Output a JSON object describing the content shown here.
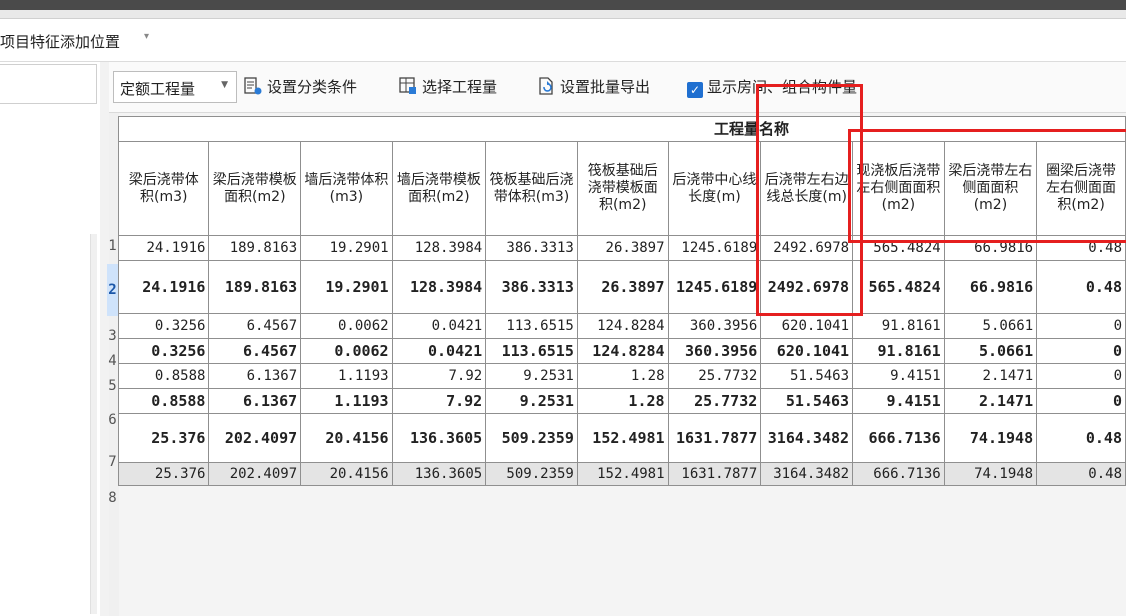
{
  "menu": {
    "label": "项目特征添加位置",
    "caret": "▾"
  },
  "toolbar": {
    "dropdown_value": "定额工程量",
    "set_classification": "设置分类条件",
    "select_quantity": "选择工程量",
    "batch_export": "设置批量导出",
    "show_rooms": "显示房间、组合构件量",
    "show_rooms_checked": true
  },
  "table": {
    "group_header": "工程量名称",
    "columns": [
      "梁后浇带体积(m3)",
      "梁后浇带模板面积(m2)",
      "墙后浇带体积(m3)",
      "墙后浇带模板面积(m2)",
      "筏板基础后浇带体积(m3)",
      "筏板基础后浇带模板面积(m2)",
      "后浇带中心线长度(m)",
      "后浇带左右边线总长度(m)",
      "现浇板后浇带左右侧面面积(m2)",
      "梁后浇带左右侧面面积(m2)",
      "圈梁后浇带左右侧面面积(m2)"
    ],
    "row_numbers": [
      "1",
      "2",
      "3",
      "4",
      "5",
      "6",
      "7",
      "8"
    ],
    "rows": [
      [
        "24.1916",
        "189.8163",
        "19.2901",
        "128.3984",
        "386.3313",
        "26.3897",
        "1245.6189",
        "2492.6978",
        "565.4824",
        "66.9816",
        "0.48"
      ],
      [
        "24.1916",
        "189.8163",
        "19.2901",
        "128.3984",
        "386.3313",
        "26.3897",
        "1245.6189",
        "2492.6978",
        "565.4824",
        "66.9816",
        "0.48"
      ],
      [
        "0.3256",
        "6.4567",
        "0.0062",
        "0.0421",
        "113.6515",
        "124.8284",
        "360.3956",
        "620.1041",
        "91.8161",
        "5.0661",
        "0"
      ],
      [
        "0.3256",
        "6.4567",
        "0.0062",
        "0.0421",
        "113.6515",
        "124.8284",
        "360.3956",
        "620.1041",
        "91.8161",
        "5.0661",
        "0"
      ],
      [
        "0.8588",
        "6.1367",
        "1.1193",
        "7.92",
        "9.2531",
        "1.28",
        "25.7732",
        "51.5463",
        "9.4151",
        "2.1471",
        "0"
      ],
      [
        "0.8588",
        "6.1367",
        "1.1193",
        "7.92",
        "9.2531",
        "1.28",
        "25.7732",
        "51.5463",
        "9.4151",
        "2.1471",
        "0"
      ],
      [
        "25.376",
        "202.4097",
        "20.4156",
        "136.3605",
        "509.2359",
        "152.4981",
        "1631.7877",
        "3164.3482",
        "666.7136",
        "74.1948",
        "0.48"
      ],
      [
        "25.376",
        "202.4097",
        "20.4156",
        "136.3605",
        "509.2359",
        "152.4981",
        "1631.7877",
        "3164.3482",
        "666.7136",
        "74.1948",
        "0.48"
      ]
    ]
  },
  "colors": {
    "highlight_box": "#e51f1f",
    "checkbox": "#1f6fd0"
  }
}
